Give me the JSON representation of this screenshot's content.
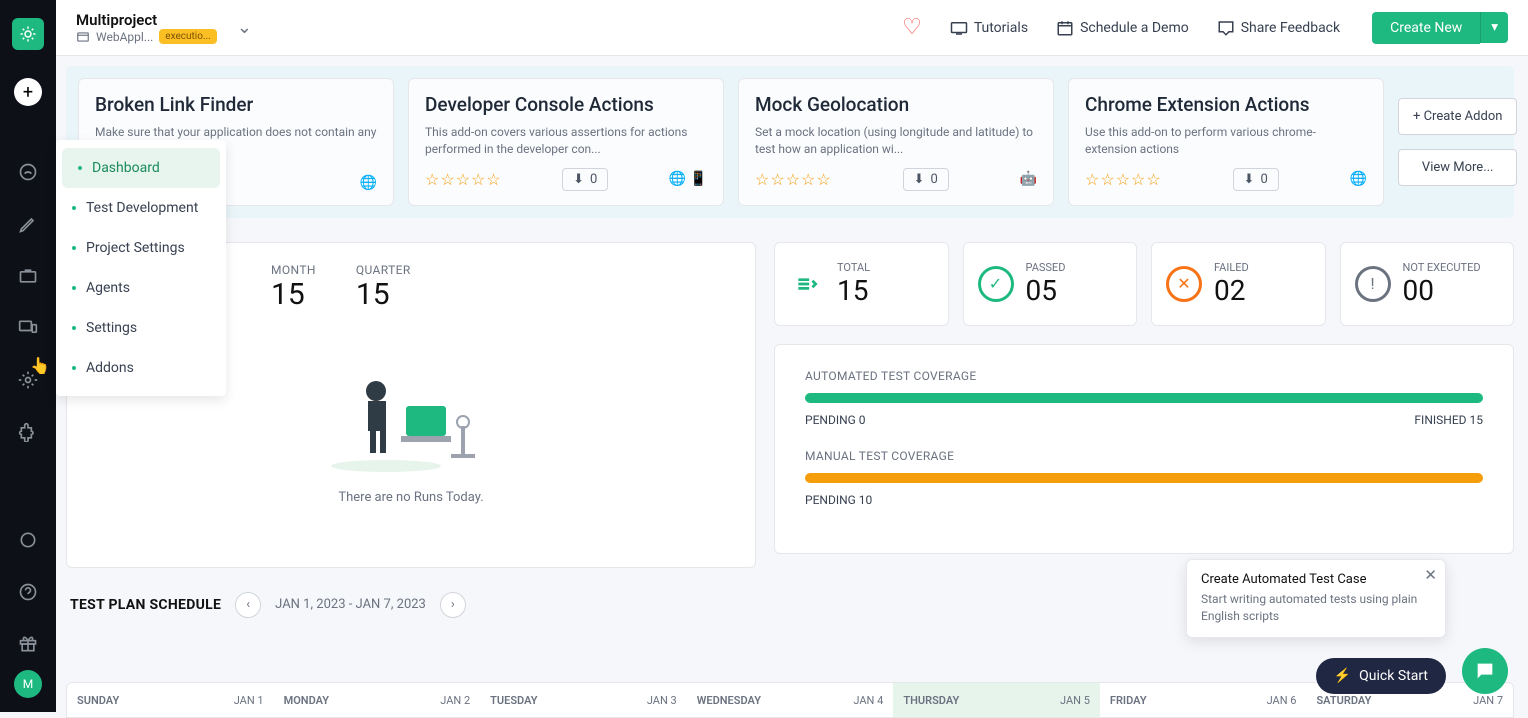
{
  "header": {
    "project_name": "Multiproject",
    "project_sub": "WebAppl...",
    "project_badge": "executio...",
    "tutorials": "Tutorials",
    "schedule_demo": "Schedule a Demo",
    "share_feedback": "Share Feedback",
    "create_new": "Create New"
  },
  "flyout": {
    "items": [
      {
        "label": "Dashboard"
      },
      {
        "label": "Test Development"
      },
      {
        "label": "Project Settings"
      },
      {
        "label": "Agents"
      },
      {
        "label": "Settings"
      },
      {
        "label": "Addons"
      }
    ]
  },
  "addons": {
    "cards": [
      {
        "title": "Broken Link Finder",
        "desc": "Make sure that your application does not contain any",
        "downloads": "",
        "platforms": "web"
      },
      {
        "title": "Developer Console Actions",
        "desc": "This add-on covers various assertions for actions performed in the developer con...",
        "downloads": "0",
        "platforms": "web-mobile"
      },
      {
        "title": "Mock Geolocation",
        "desc": "Set a mock location (using longitude and latitude) to test how an application wi...",
        "downloads": "0",
        "platforms": "android-apple"
      },
      {
        "title": "Chrome Extension Actions",
        "desc": "Use this add-on to perform various chrome-extension actions",
        "downloads": "0",
        "platforms": "web"
      }
    ],
    "create_btn": "+ Create Addon",
    "view_more": "View More..."
  },
  "runs": {
    "month_label": "MONTH",
    "month_val": "15",
    "quarter_label": "QUARTER",
    "quarter_val": "15",
    "empty_msg": "There are no Runs Today."
  },
  "status": {
    "total_label": "TOTAL",
    "total_val": "15",
    "passed_label": "PASSED",
    "passed_val": "05",
    "failed_label": "FAILED",
    "failed_val": "02",
    "notexec_label": "NOT EXECUTED",
    "notexec_val": "00"
  },
  "coverage": {
    "auto_label": "AUTOMATED TEST COVERAGE",
    "auto_pending": "PENDING 0",
    "auto_finished": "FINISHED 15",
    "manual_label": "MANUAL TEST COVERAGE",
    "manual_pending": "PENDING 10"
  },
  "schedule": {
    "title": "TEST PLAN SCHEDULE",
    "range": "JAN 1, 2023 - JAN 7, 2023",
    "days": [
      {
        "date": "JAN 1",
        "dow": "SUNDAY"
      },
      {
        "date": "JAN 2",
        "dow": "MONDAY"
      },
      {
        "date": "JAN 3",
        "dow": "TUESDAY"
      },
      {
        "date": "JAN 4",
        "dow": "WEDNESDAY"
      },
      {
        "date": "JAN 5",
        "dow": "THURSDAY"
      },
      {
        "date": "JAN 6",
        "dow": "FRIDAY"
      },
      {
        "date": "JAN 7",
        "dow": "SATURDAY"
      }
    ]
  },
  "tooltip": {
    "title": "Create Automated Test Case",
    "desc": "Start writing automated tests using plain English scripts"
  },
  "quickstart": "Quick Start",
  "rail_avatar": "M"
}
